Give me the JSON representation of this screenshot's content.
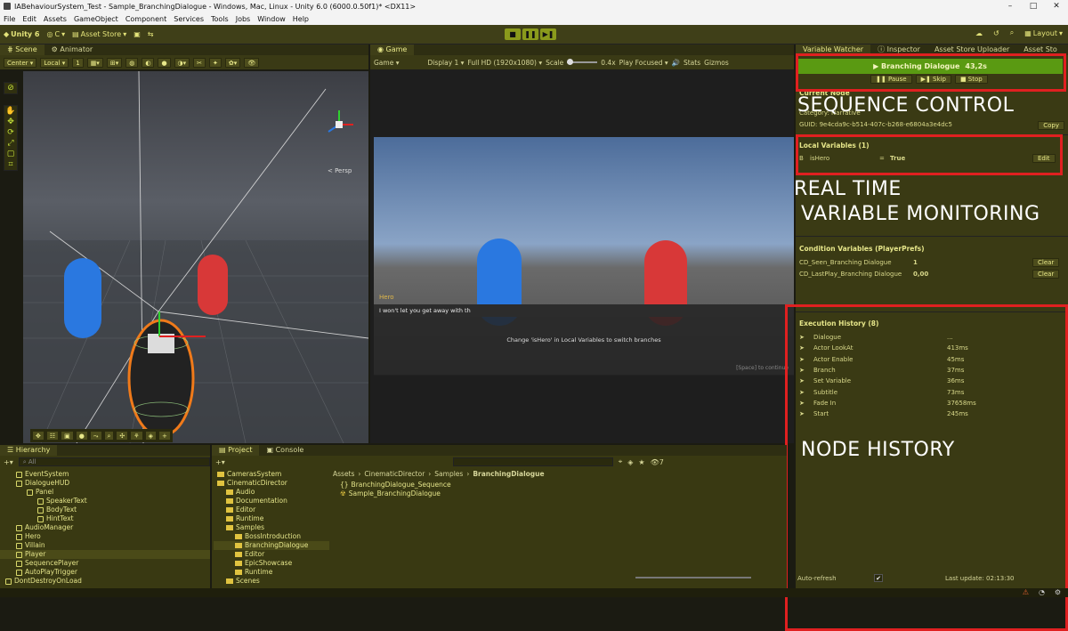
{
  "window": {
    "title": "IABehaviourSystem_Test - Sample_BranchingDialogue - Windows, Mac, Linux - Unity 6.0 (6000.0.50f1)* <DX11>",
    "controls": [
      "–",
      "□",
      "✕"
    ]
  },
  "menu": [
    "File",
    "Edit",
    "Assets",
    "GameObject",
    "Component",
    "Services",
    "Tools",
    "Jobs",
    "Window",
    "Help"
  ],
  "toolbar": {
    "unity_label": "Unity 6",
    "account_label": "C",
    "asset_store_label": "Asset Store",
    "layout_label": "Layout"
  },
  "scene": {
    "tabs": [
      "Scene",
      "Animator"
    ],
    "pivot_center": "Center",
    "pivot_local": "Local",
    "grid_value": "1",
    "persp_label": "< Persp"
  },
  "game": {
    "tab": "Game",
    "mode": "Game",
    "display": "Display 1",
    "resolution": "Full HD (1920x1080)",
    "scale_label": "Scale",
    "scale_value": "0.4x",
    "play_focused": "Play Focused",
    "stats": "Stats",
    "gizmos": "Gizmos",
    "speaker": "Hero",
    "body_text": "I won't let you get away with th",
    "hint_text": "Change 'isHero' in Local Variables to switch branches",
    "continue_text": "[Space] to continue"
  },
  "right_tabs": [
    "Variable Watcher",
    "Inspector",
    "Asset Store Uploader",
    "Asset Sto"
  ],
  "watcher": {
    "sequence": {
      "title": "▶ Branching Dialogue",
      "time": "43,2s",
      "pause": "Pause",
      "skip": "Skip",
      "stop": "Stop"
    },
    "current_node": {
      "heading": "Current Node",
      "category": "Category: Narrative",
      "guid": "GUID: 9e4cda9c-b514-407c-b268-e6804a3e4dc5",
      "copy": "Copy"
    },
    "local_vars": {
      "heading": "Local Variables (1)",
      "rows": [
        {
          "type": "B",
          "name": "isHero",
          "eq": "=",
          "value": "True",
          "action": "Edit"
        }
      ]
    },
    "condition_vars": {
      "heading": "Condition Variables (PlayerPrefs)",
      "rows": [
        {
          "name": "CD_Seen_Branching Dialogue",
          "value": "1",
          "action": "Clear"
        },
        {
          "name": "CD_LastPlay_Branching Dialogue",
          "value": "0,00",
          "action": "Clear"
        }
      ]
    },
    "history": {
      "heading": "Execution History (8)",
      "rows": [
        {
          "name": "Dialogue",
          "time": "..."
        },
        {
          "name": "Actor LookAt",
          "time": "413ms"
        },
        {
          "name": "Actor Enable",
          "time": "45ms"
        },
        {
          "name": "Branch",
          "time": "37ms"
        },
        {
          "name": "Set Variable",
          "time": "36ms"
        },
        {
          "name": "Subtitle",
          "time": "73ms"
        },
        {
          "name": "Fade In",
          "time": "37658ms"
        },
        {
          "name": "Start",
          "time": "245ms"
        }
      ]
    },
    "footer": {
      "auto_refresh": "Auto-refresh",
      "last_update": "Last update: 02:13:30"
    }
  },
  "annotations": {
    "sequence_control": "SEQUENCE CONTROL",
    "realtime_1": "REAL TIME",
    "realtime_2": "VARIABLE MONITORING",
    "node_history": "NODE HISTORY"
  },
  "hierarchy": {
    "tab": "Hierarchy",
    "search_placeholder": "All",
    "items": [
      {
        "label": "EventSystem",
        "indent": 1
      },
      {
        "label": "DialogueHUD",
        "indent": 1
      },
      {
        "label": "Panel",
        "indent": 2
      },
      {
        "label": "SpeakerText",
        "indent": 3
      },
      {
        "label": "BodyText",
        "indent": 3
      },
      {
        "label": "HintText",
        "indent": 3
      },
      {
        "label": "AudioManager",
        "indent": 1
      },
      {
        "label": "Hero",
        "indent": 1
      },
      {
        "label": "Villain",
        "indent": 1
      },
      {
        "label": "Player",
        "indent": 1
      },
      {
        "label": "SequencePlayer",
        "indent": 1
      },
      {
        "label": "AutoPlayTrigger",
        "indent": 1
      },
      {
        "label": "DontDestroyOnLoad",
        "indent": 0
      }
    ]
  },
  "project": {
    "tabs": [
      "Project",
      "Console"
    ],
    "tree": [
      {
        "label": "CamerasSystem",
        "indent": 1
      },
      {
        "label": "CinematicDirector",
        "indent": 1
      },
      {
        "label": "Audio",
        "indent": 2
      },
      {
        "label": "Documentation",
        "indent": 2
      },
      {
        "label": "Editor",
        "indent": 2
      },
      {
        "label": "Runtime",
        "indent": 2
      },
      {
        "label": "Samples",
        "indent": 2
      },
      {
        "label": "BossIntroduction",
        "indent": 3
      },
      {
        "label": "BranchingDialogue",
        "indent": 3
      },
      {
        "label": "Editor",
        "indent": 3
      },
      {
        "label": "EpicShowcase",
        "indent": 3
      },
      {
        "label": "Runtime",
        "indent": 3
      },
      {
        "label": "Scenes",
        "indent": 2
      }
    ],
    "breadcrumb": [
      "Assets",
      "CinematicDirector",
      "Samples",
      "BranchingDialogue"
    ],
    "files": [
      "BranchingDialogue_Sequence",
      "Sample_BranchingDialogue"
    ],
    "count": "7"
  },
  "colors": {
    "accent_green": "#5a9a12",
    "annotation_red": "#e02020",
    "capsule_blue": "#2a78e0",
    "capsule_red": "#d83838"
  }
}
